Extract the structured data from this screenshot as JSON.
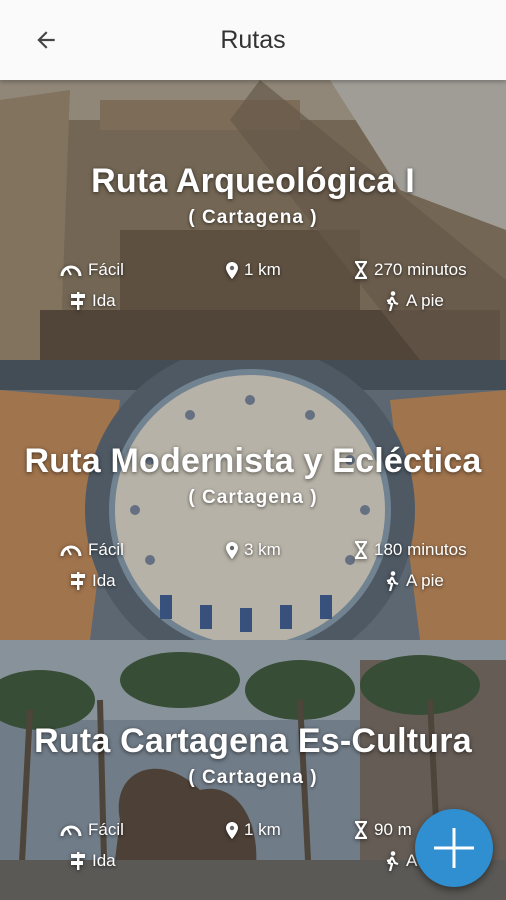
{
  "appbar": {
    "title": "Rutas",
    "back_icon": "arrow-left-icon"
  },
  "routes": [
    {
      "title": "Ruta Arqueológica I",
      "city": "( Cartagena )",
      "difficulty": "Fácil",
      "distance": "1 km",
      "duration": "270 minutos",
      "direction": "Ida",
      "mode": "A pie"
    },
    {
      "title": "Ruta Modernista y Ecléctica",
      "city": "( Cartagena )",
      "difficulty": "Fácil",
      "distance": "3 km",
      "duration": "180 minutos",
      "direction": "Ida",
      "mode": "A pie"
    },
    {
      "title": "Ruta Cartagena Es-Cultura",
      "city": "( Cartagena )",
      "difficulty": "Fácil",
      "distance": "1 km",
      "duration": "90 m",
      "direction": "Ida",
      "mode": "A pie"
    }
  ],
  "fab": {
    "icon": "plus-icon",
    "color": "#2f8fd0"
  }
}
